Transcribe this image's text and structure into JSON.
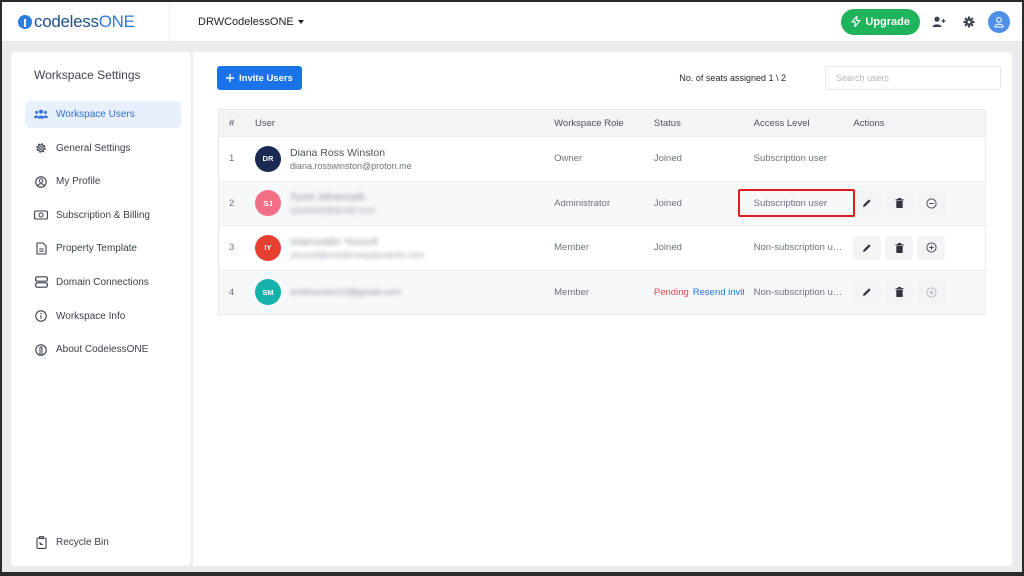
{
  "topbar": {
    "logo_text_a": "codeless",
    "logo_text_b": "ONE",
    "workspace_name": "DRWCodelessONE",
    "upgrade_label": "Upgrade",
    "brand_color": "#2a7de1",
    "upgrade_color": "#1fb45b"
  },
  "sidebar": {
    "title": "Workspace Settings",
    "items": [
      {
        "label": "Workspace Users",
        "icon": "users-icon",
        "active": true
      },
      {
        "label": "General Settings",
        "icon": "gear-icon"
      },
      {
        "label": "My Profile",
        "icon": "user-circle-icon"
      },
      {
        "label": "Subscription & Billing",
        "icon": "money-icon"
      },
      {
        "label": "Property Template",
        "icon": "document-icon"
      },
      {
        "label": "Domain Connections",
        "icon": "server-icon"
      },
      {
        "label": "Workspace Info",
        "icon": "info-icon"
      },
      {
        "label": "About CodelessONE",
        "icon": "codelessone-logo-icon"
      }
    ],
    "bottom_item": {
      "label": "Recycle Bin",
      "icon": "recycle-bin-icon"
    }
  },
  "main": {
    "invite_label": "Invite Users",
    "seats_text": "No. of seats assigned 1 \\ 2",
    "search_placeholder": "Search users",
    "columns": [
      "#",
      "User",
      "Workspace Role",
      "Status",
      "Access Level",
      "Actions"
    ],
    "rows": [
      {
        "num": "1",
        "initials": "DR",
        "avatar_color": "#1b2a52",
        "name": "Diana Ross Winston",
        "email": "diana.rosswinston@proton.me",
        "name_blurred": false,
        "role": "Owner",
        "status": "Joined",
        "access": "Subscription user",
        "actions": false
      },
      {
        "num": "2",
        "initials": "SJ",
        "avatar_color": "#f36f86",
        "name": "Syed Jahanzaib",
        "email": "sjsaibaib@gmail.com",
        "name_blurred": true,
        "role": "Administrator",
        "status": "Joined",
        "access": "Subscription user",
        "actions": true,
        "toggle": "minus"
      },
      {
        "num": "3",
        "initials": "IY",
        "avatar_color": "#e43f2f",
        "name": "Islamuddin Yousufi",
        "email": "yousufi@modernequipments.com",
        "name_blurred": true,
        "role": "Member",
        "status": "Joined",
        "access": "Non-subscription user",
        "actions": true,
        "toggle": "plus"
      },
      {
        "num": "4",
        "initials": "SM",
        "avatar_color": "#16b3aa",
        "name": "",
        "email": "smkhurram12@gmail.com",
        "name_blurred": true,
        "role": "Member",
        "status": "Pending",
        "resend": "Resend invite",
        "access": "Non-subscription user",
        "actions": true,
        "toggle": "plus-disabled"
      }
    ]
  }
}
